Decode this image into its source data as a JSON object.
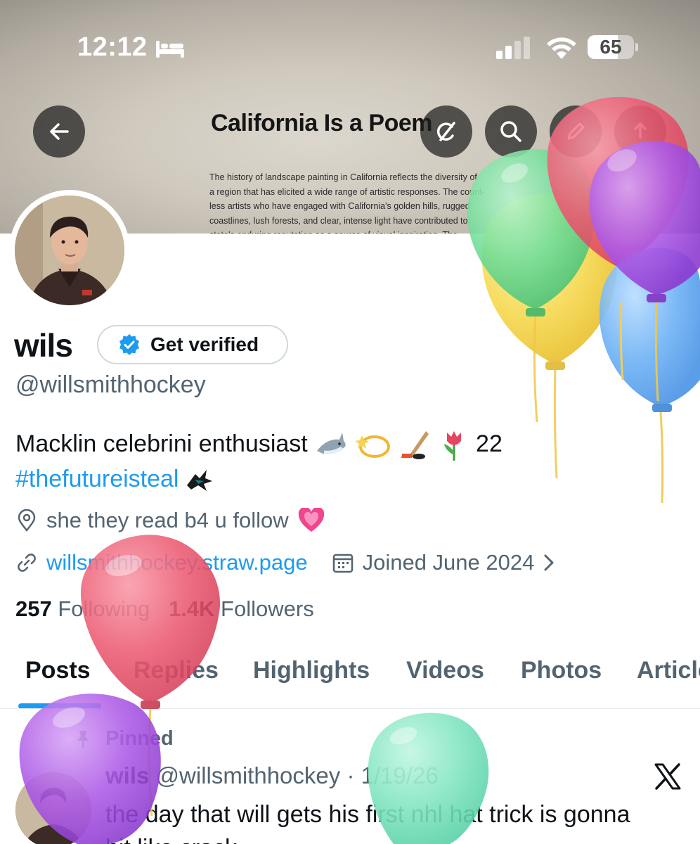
{
  "status_bar": {
    "time": "12:12",
    "battery": "65",
    "battery_level": 0.65
  },
  "banner": {
    "title": "California Is a Poem",
    "text_lines": [
      "The history of landscape painting in California reflects the diversity of",
      "a region that has elicited a wide range of artistic responses. The count-",
      "less artists who have engaged with California's golden hills, rugged",
      "coastlines, lush forests, and clear, intense light have contributed to",
      "state's enduring reputation as a source of visual inspiration. The"
    ]
  },
  "header_buttons": {
    "back": "back-arrow-icon",
    "grok": "grok-icon",
    "search": "search-icon",
    "edit": "edit-icon",
    "share": "share-icon"
  },
  "profile": {
    "name": "wils",
    "verify_label": "Get verified",
    "handle": "@willsmithhockey",
    "bio_line1": "Macklin celebrini enthusiast",
    "bio_emojis_tail": "22",
    "hashtag": "#thefutureisteal",
    "location": "she they read b4 u follow",
    "website": "willsmithhockey.straw.page",
    "joined": "Joined June 2024",
    "following_count": "257",
    "following_label": "Following",
    "followers_count": "1.4K",
    "followers_label": "Followers"
  },
  "tabs": [
    {
      "label": "Posts",
      "active": true
    },
    {
      "label": "Replies",
      "active": false
    },
    {
      "label": "Highlights",
      "active": false
    },
    {
      "label": "Videos",
      "active": false
    },
    {
      "label": "Photos",
      "active": false
    },
    {
      "label": "Articles",
      "active": false
    }
  ],
  "post": {
    "pinned_label": "Pinned",
    "name": "wils",
    "handle": "@willsmithhockey",
    "date": "· 1/19/26",
    "text_line1": "the day that will gets his first nhl hat trick is gonna",
    "text_line2": "hit like crack"
  },
  "colors": {
    "accent": "#1d9bf0",
    "text_primary": "#0f1419",
    "text_secondary": "#536471"
  }
}
